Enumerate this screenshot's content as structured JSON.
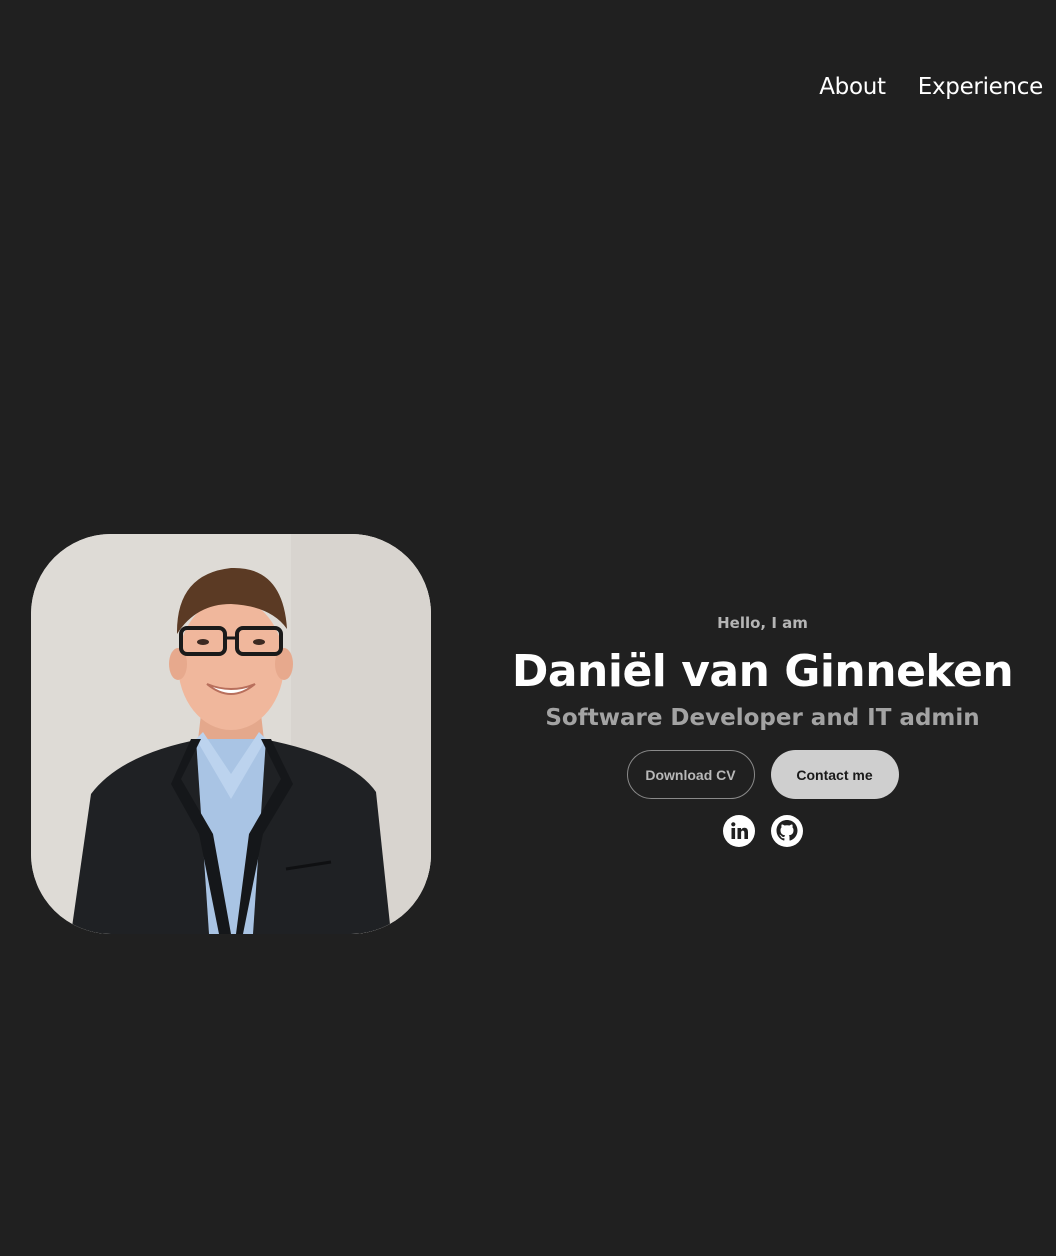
{
  "nav": {
    "items": [
      {
        "label": "About"
      },
      {
        "label": "Experience"
      }
    ]
  },
  "profile": {
    "photo_alt": "Profile picture",
    "greeting": "Hello, I am",
    "name": "Daniël van Ginneken",
    "title": "Software Developer and IT admin"
  },
  "buttons": {
    "download_cv": "Download CV",
    "contact": "Contact me"
  },
  "socials": [
    {
      "icon": "linkedin-icon"
    },
    {
      "icon": "github-icon"
    }
  ],
  "colors": {
    "background": "#202020",
    "text_primary": "#ffffff",
    "text_secondary": "#a3a3a3",
    "button_solid": "#cfcfcf"
  }
}
